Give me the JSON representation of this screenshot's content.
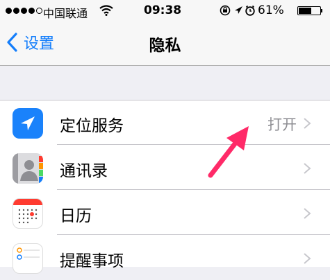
{
  "status_bar": {
    "carrier": "中国联通",
    "time": "09:38",
    "battery_percent": "61%",
    "battery_level": 0.61
  },
  "nav": {
    "back_label": "设置",
    "title": "隐私"
  },
  "rows": [
    {
      "label": "定位服务",
      "value": "打开",
      "icon": "location-services-icon"
    },
    {
      "label": "通讯录",
      "icon": "contacts-icon"
    },
    {
      "label": "日历",
      "icon": "calendar-icon"
    },
    {
      "label": "提醒事项",
      "icon": "reminders-icon"
    }
  ],
  "colors": {
    "accent": "#147efb",
    "annotation_arrow": "#ff2a68"
  }
}
